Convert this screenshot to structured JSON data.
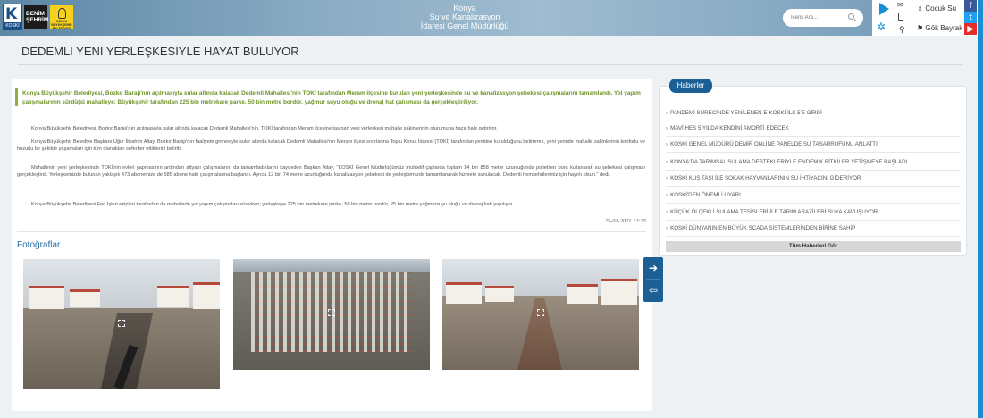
{
  "header": {
    "logos": {
      "koski_letter": "K",
      "koski_text": "KOSKİ",
      "benim_line1": "BENİM",
      "benim_line2": "ŞEHRİM",
      "buyuksehir_text": "KONYA BÜYÜKŞEHİR BELEDİYESİ"
    },
    "title_line1": "Konya",
    "title_line2": "Su ve Kanalizasyon",
    "title_line3": "İdaresi Genel Müdürlüğü",
    "search_placeholder": "İçerik Ara...",
    "cocuk_su": "Çocuk Su",
    "gok_bayrak": "Gök Bayrak",
    "social": {
      "facebook": "f",
      "twitter": "t",
      "youtube": "▶"
    }
  },
  "page_title": "DEDEMLİ YENİ YERLEŞKESİYLE HAYAT BULUYOR",
  "article": {
    "lead": "Konya Büyükşehir Belediyesi, Bozkır Barajı'nın açılmasıyla sular altında kalacak Dedemli Mahallesi'nin TOKİ tarafından Meram ilçesine kurulan yeni yerleşkesinde su ve kanalizasyon şebekesi çalışmalarını tamamlandı. Yol yapım çalışmalarının sürdüğü mahalleye; Büyükşehir tarafından 225 bin metrekare parke, 50 bin metre bordür, yağmur suyu oluğu ve drenaj hat çalışması da gerçekleştiriliyor.",
    "paragraphs": [
      "Konya Büyükşehir Belediyesi, Bozkır Barajı'nın açılmasıyla sular altında kalacak Dedemli Mahallesi'nin, TOKİ tarafından Meram ilçesine taşınan yeni yerleşkesi mahalle sakinlerinin oturumuna hazır hale getiriyor.",
      "Konya Büyükşehir Belediye Başkanı Uğur İbrahim Altay, Bozkır Barajı'nın faaliyete girmesiyle sular altında kalacak Dedemli Mahallesi'nin Meram ilçesi sınırlarına Toplu Konut İdaresi (TOKİ) tarafından yeniden kurulduğunu belirterek, yeni yerinde mahalle sakinlerinin konforlu ve huzurlu bir şekilde yaşamaları için tüm olanakları seferber ettiklerini belirtti.",
      "Mahallenin yeni yerleşkesinde TOKİ'nin evleri yapmasının ardından altyapı çalışmalarını da tamamladıklarını kaydeden Başkan Altay, \"KOSKİ Genel Müdürlüğümüz muhtelif çaplarda toplam 14 bin 858 metre uzunluğunda polietilen boru kullanarak su şebekesi çalışması gerçekleştirdi. Yerleşkemizde bulunan yaklaşık 473 abonemize de 585 abone hattı çalışmalarına başlandı. Ayrıca 12 bin 74 metre uzunluğunda kanalizasyon şebekesi de yerleşkemizde tamamlanarak hizmete sunulacak. Dedemli hemşehrilerimiz için hayırlı olsun.\" dedi.",
      "Konya Büyükşehir Belediyesi Fen İşleri ekipleri tarafından da mahallede yol yapım çalışmaları sürerken; yerleşkeye 225 bin metrekare parke, 50 bin metre bordür, 25 bin metre yağmursuyu oluğu ve drenaj hatı yapılıyor."
    ],
    "date": "25-01-2021 12:35",
    "photos_title": "Fotoğraflar"
  },
  "news": {
    "tab_label": "Haberler",
    "items": [
      "PANDEMİ SÜRECİNDE YENİLENEN E-KOSKİ İLK 5'E GİRDİ",
      "MAVİ HES 5 YILDA KENDİNİ AMORTİ EDECEK",
      "KOSKİ GENEL MÜDÜRÜ DEMİR ONLİNE PANELDE SU TASARRUFUNU ANLATTI",
      "KONYA'DA TARIMSAL SULAMA DESTEKLERİYLE ENDEMİK BİTKİLER YETİŞMEYE BAŞLADI",
      "KOSKİ KUŞ TASI İLE SOKAK HAYVANLARININ SU İHTİYACINI GİDERİYOR",
      "KOSKİ'DEN ÖNEMLİ UYARI",
      "KÜÇÜK ÖLÇEKLİ SULAMA TESİSLERİ İLE TARIM ARAZİLERİ SUYA KAVUŞUYOR",
      "KOSKİ DÜNYANIN EN BÜYÜK SCADA SİSTEMLERİNDEN BİRİNE SAHİP"
    ],
    "all_label": "Tüm Haberleri Gör"
  },
  "colors": {
    "accent_blue": "#1c5f95",
    "lead_green": "#6f9428",
    "header_blue": "#87a9c2"
  }
}
